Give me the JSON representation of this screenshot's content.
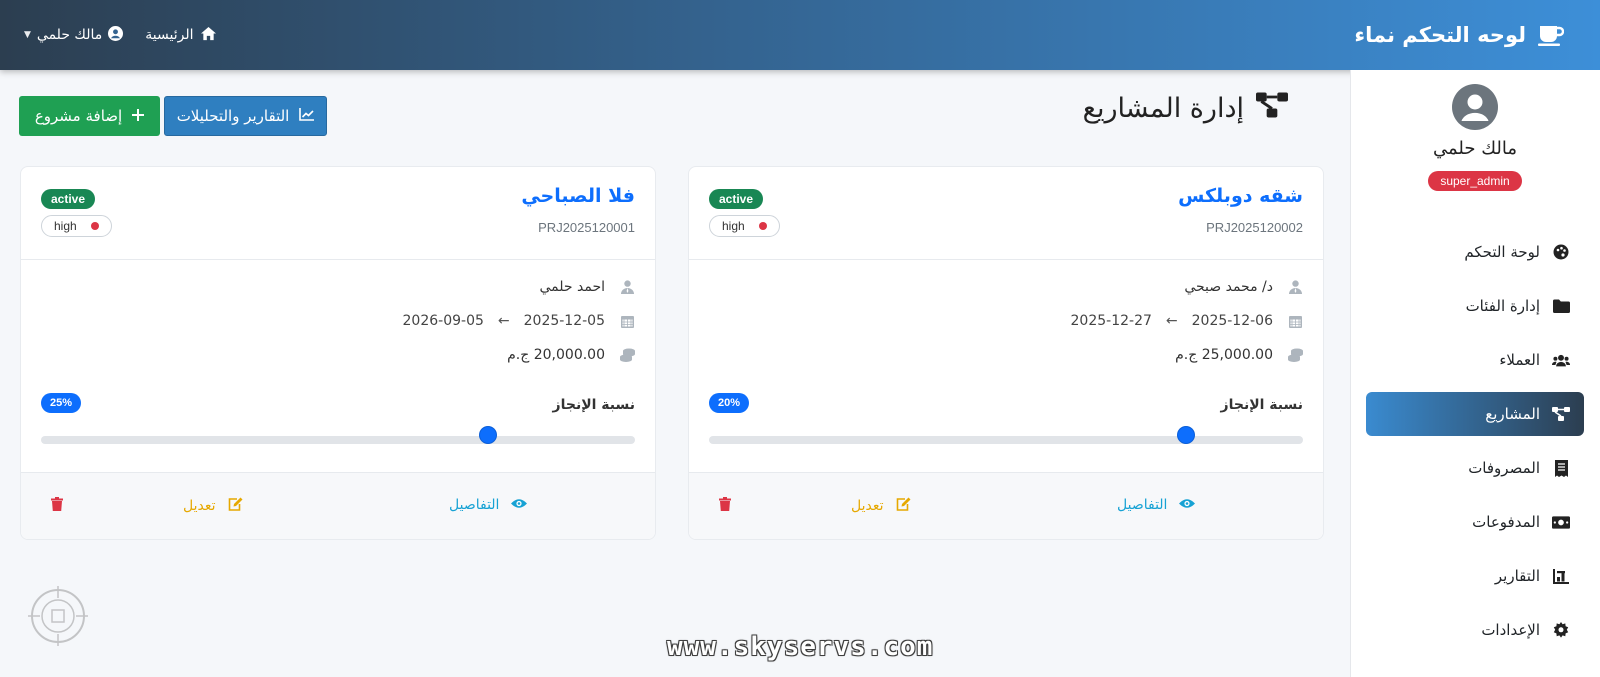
{
  "navbar": {
    "brand_title": "لوحه التحكم نماء",
    "home_label": "الرئيسية",
    "user_label": "مالك حلمي"
  },
  "sidebar": {
    "profile_name": "مالك حلمي",
    "role": "super_admin",
    "items": [
      {
        "label": "لوحة التحكم",
        "icon": "palette-icon"
      },
      {
        "label": "إدارة الفئات",
        "icon": "folder-icon"
      },
      {
        "label": "العملاء",
        "icon": "users-icon"
      },
      {
        "label": "المشاريع",
        "icon": "project-diagram-icon",
        "active": true
      },
      {
        "label": "المصروفات",
        "icon": "receipt-icon"
      },
      {
        "label": "المدفوعات",
        "icon": "money-bill-icon"
      },
      {
        "label": "التقارير",
        "icon": "chart-bar-icon"
      },
      {
        "label": "الإعدادات",
        "icon": "gear-icon"
      }
    ]
  },
  "main": {
    "page_title": "إدارة المشاريع",
    "reports_button": "التقارير والتحليلات",
    "add_button": "إضافة مشروع",
    "progress_label": "نسبة الإنجاز",
    "details_label": "التفاصيل",
    "edit_label": "تعديل",
    "projects": [
      {
        "title": "شقه دوبلكس",
        "code": "PRJ2025120002",
        "status": "active",
        "priority": "high",
        "client": "د/ محمد صبحي",
        "start_date": "2025-12-06",
        "end_date": "2025-12-27",
        "budget": "25,000.00 ج.م",
        "progress_text": "20%",
        "slider_value": 0.8
      },
      {
        "title": "فلا الصباحي",
        "code": "PRJ2025120001",
        "status": "active",
        "priority": "high",
        "client": "احمد حلمي",
        "start_date": "2025-12-05",
        "end_date": "2026-09-05",
        "budget": "20,000.00 ج.م",
        "progress_text": "25%",
        "slider_value": 0.75
      }
    ]
  },
  "watermark": "www.skyservs.com",
  "colors": {
    "primary": "#0d6efd",
    "success": "#198754",
    "danger": "#dc3545",
    "warning": "#e6a800",
    "info": "#17a2d4"
  }
}
